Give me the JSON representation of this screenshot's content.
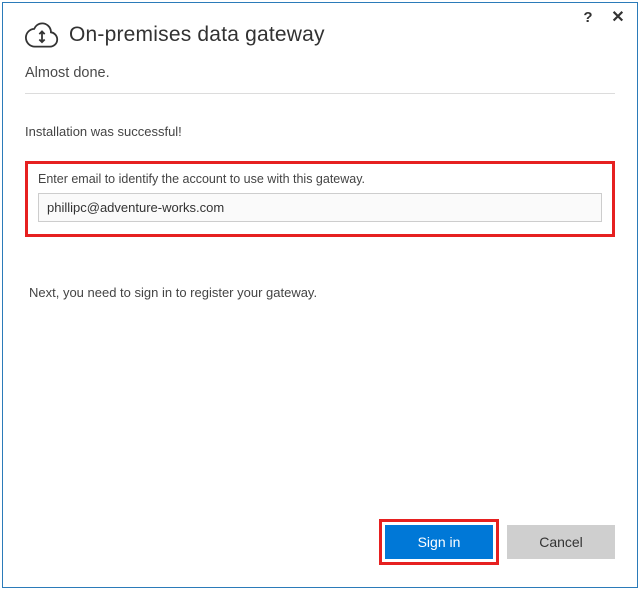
{
  "header": {
    "title": "On-premises data gateway"
  },
  "subtitle": "Almost done.",
  "status": "Installation was successful!",
  "emailSection": {
    "label": "Enter email to identify the account to use with this gateway.",
    "value": "phillipc@adventure-works.com"
  },
  "nextStep": "Next, you need to sign in to register your gateway.",
  "buttons": {
    "signin": "Sign in",
    "cancel": "Cancel"
  },
  "controls": {
    "help": "?",
    "close": "✕"
  }
}
